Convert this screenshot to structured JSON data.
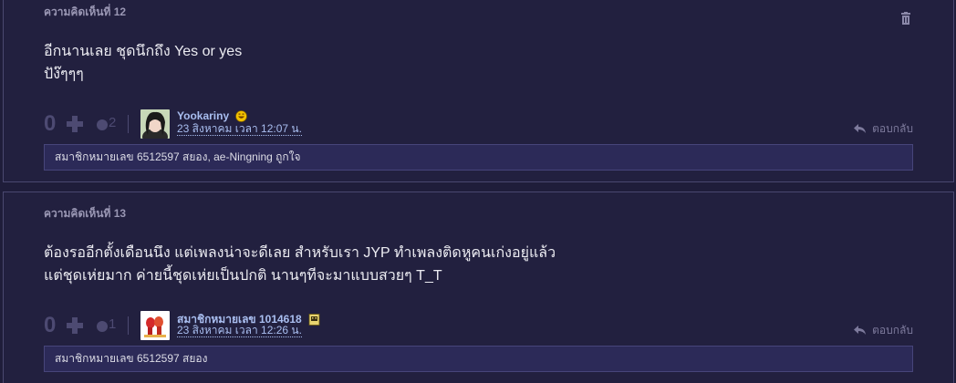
{
  "comments": [
    {
      "title": "ความคิดเห็นที่ 12",
      "body_lines": [
        "อีกนานเลย ชุดนึกถึง Yes or yes",
        "ปัง๊ๆๆๆ"
      ],
      "votes": "0",
      "emotion_count": "2",
      "username": "Yookariny",
      "timestamp": "23 สิงหาคม เวลา 12:07 น.",
      "reply_label": "ตอบกลับ",
      "reactions": "สมาชิกหมายเลข 6512597 สยอง, ae-Ningning ถูกใจ",
      "icons": {
        "delete": "trash-icon",
        "badge": "smiley-badge-icon"
      }
    },
    {
      "title": "ความคิดเห็นที่ 13",
      "body_lines": [
        "ต้องรออีกตั้งเดือนนึง แต่เพลงน่าจะดีเลย สำหรับเรา JYP ทำเพลงติดหูคนเก่งอยู่แล้ว",
        "แต่ชุดเห่ยมาก ค่ายนี้ชุดเห่ยเป็นปกติ นานๆทีจะมาแบบสวยๆ T_T"
      ],
      "votes": "0",
      "emotion_count": "1",
      "username": "สมาชิกหมายเลข 1014618",
      "timestamp": "23 สิงหาคม เวลา 12:26 น.",
      "reply_label": "ตอบกลับ",
      "reactions": "สมาชิกหมายเลข 6512597 สยอง",
      "icons": {
        "badge": "member-badge-icon"
      }
    }
  ],
  "colors": {
    "background": "#1f1d3a",
    "card": "#22203f",
    "link": "#a9bef0",
    "muted": "#4d4a72",
    "reaction_bar": "#2c2a58"
  }
}
